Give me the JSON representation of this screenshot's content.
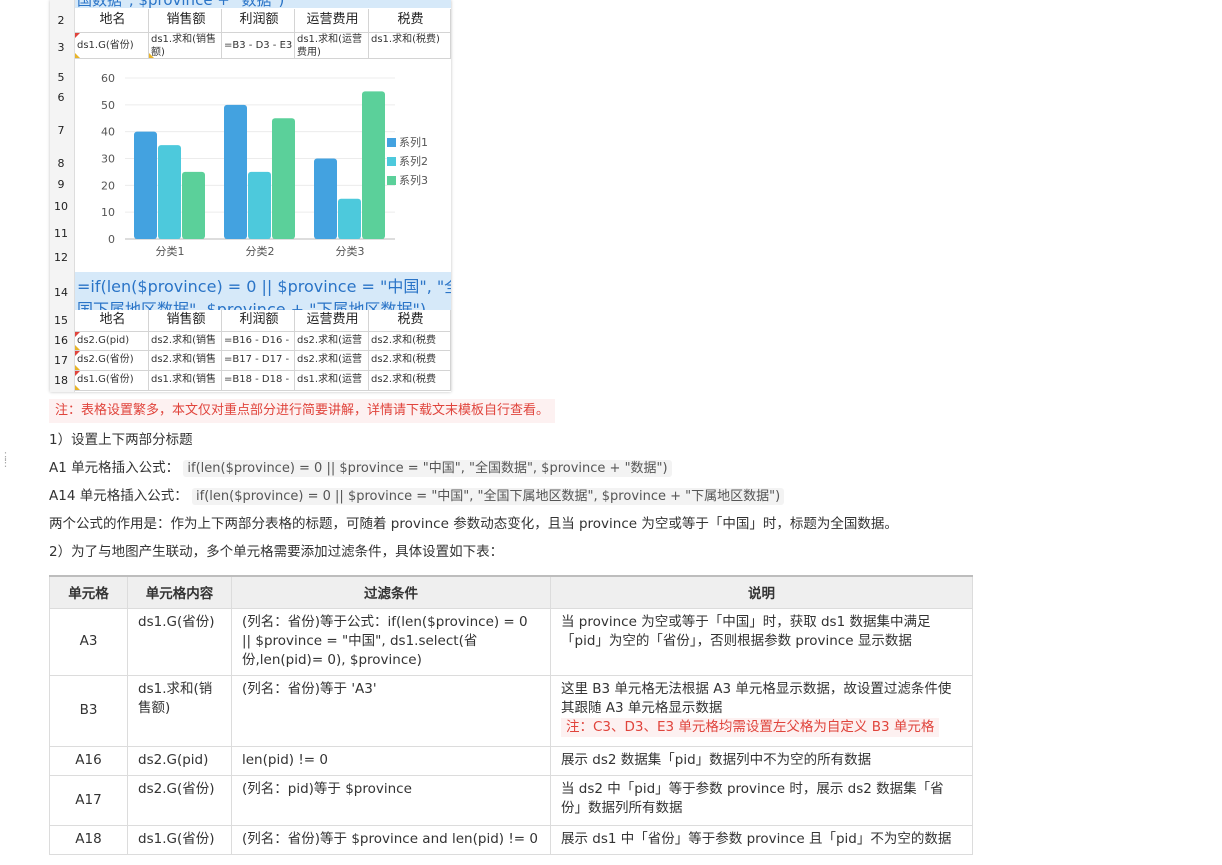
{
  "sheet": {
    "top_band_text": "国数据\", $province + \"数据\")",
    "rows": [
      "2",
      "3",
      "5",
      "6",
      "7",
      "8",
      "9",
      "10",
      "11",
      "12",
      "14",
      "15",
      "16",
      "17",
      "18"
    ],
    "header_labels": [
      "地名",
      "销售额",
      "利润额",
      "运营费用",
      "税费"
    ],
    "row3_cells": [
      "ds1.G(省份)",
      "ds1.求和(销售额)",
      "=B3 - D3 - E3",
      "ds1.求和(运营费用)",
      "ds1.求和(税费)"
    ],
    "band14_line1": "=if(len($province) = 0 || $province = \"中国\", \"全",
    "band14_line2": "国下属地区数据\", $province + \"下属地区数据\")",
    "header2_labels": [
      "地名",
      "销售额",
      "利润额",
      "运营费用",
      "税费"
    ],
    "row16_cells": [
      "ds2.G(pid)",
      "ds2.求和(销售",
      "=B16 - D16 -",
      "ds2.求和(运营",
      "ds2.求和(税费"
    ],
    "row17_cells": [
      "ds2.G(省份)",
      "ds2.求和(销售",
      "=B17 - D17 -",
      "ds2.求和(运营",
      "ds2.求和(税费"
    ],
    "row18_cells": [
      "ds1.G(省份)",
      "ds1.求和(销售",
      "=B18 - D18 -",
      "ds1.求和(运营",
      "ds2.求和(税费"
    ]
  },
  "chart_data": {
    "type": "bar",
    "categories": [
      "分类1",
      "分类2",
      "分类3"
    ],
    "series": [
      {
        "name": "系列1",
        "values": [
          40,
          50,
          30
        ],
        "color": "#43a2e0"
      },
      {
        "name": "系列2",
        "values": [
          35,
          25,
          15
        ],
        "color": "#4dc9dc"
      },
      {
        "name": "系列3",
        "values": [
          25,
          45,
          55
        ],
        "color": "#5bd09a"
      }
    ],
    "ylim": [
      0,
      60
    ],
    "yticks": [
      "0",
      "10",
      "20",
      "30",
      "40",
      "50",
      "60"
    ],
    "legend": "right",
    "grid": true
  },
  "note": "注：表格设置繁多，本文仅对重点部分进行简要讲解，详情请下载文末模板自行查看。",
  "section1_title": "1）设置上下两部分标题",
  "a1_label": "A1 单元格插入公式：",
  "a1_formula": "if(len($province) = 0 || $province = \"中国\", \"全国数据\", $province + \"数据\")",
  "a14_label": "A14 单元格插入公式：",
  "a14_formula": "if(len($province) = 0 || $province = \"中国\", \"全国下属地区数据\", $province + \"下属地区数据\")",
  "purpose_text": "两个公式的作用是：作为上下两部分表格的标题，可随着 province 参数动态变化，且当 province 为空或等于「中国」时，标题为全国数据。",
  "section2_title": "2）为了与地图产生联动，多个单元格需要添加过滤条件，具体设置如下表：",
  "table": {
    "headers": [
      "单元格",
      "单元格内容",
      "过滤条件",
      "说明"
    ],
    "rows": [
      {
        "cell": "A3",
        "content": "ds1.G(省份)",
        "filter": "(列名：省份)等于公式：if(len($province) = 0 || $province = \"中国\", ds1.select(省份,len(pid)= 0), $province)",
        "desc": "当 province 为空或等于「中国」时，获取 ds1 数据集中满足「pid」为空的「省份」，否则根据参数 province 显示数据",
        "desc_note": ""
      },
      {
        "cell": "B3",
        "content": "ds1.求和(销售额)",
        "filter": "(列名：省份)等于 'A3'",
        "desc": "这里 B3 单元格无法根据 A3 单元格显示数据，故设置过滤条件使其跟随 A3 单元格显示数据",
        "desc_note": "注：C3、D3、E3 单元格均需设置左父格为自定义 B3 单元格"
      },
      {
        "cell": "A16",
        "content": "ds2.G(pid)",
        "filter": "len(pid) != 0",
        "desc": "展示 ds2 数据集「pid」数据列中不为空的所有数据",
        "desc_note": ""
      },
      {
        "cell": "A17",
        "content": "ds2.G(省份)",
        "filter": "(列名：pid)等于 $province",
        "desc": "当 ds2 中「pid」等于参数 province 时，展示 ds2 数据集「省份」数据列所有数据",
        "desc_note": ""
      },
      {
        "cell": "A18",
        "content": "ds1.G(省份)",
        "filter": "(列名：省份)等于 $province and len(pid) != 0",
        "desc": "展示 ds1 中「省份」等于参数 province 且「pid」不为空的数据",
        "desc_note": ""
      }
    ]
  }
}
